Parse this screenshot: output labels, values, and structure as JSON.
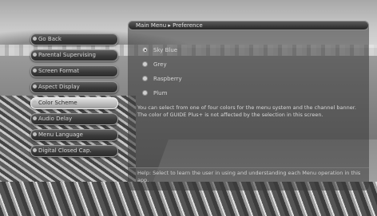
{
  "panel": {
    "title": "Main Menu ▸ Preference",
    "options": [
      {
        "label": "Sky Blue",
        "selected": true
      },
      {
        "label": "Grey",
        "selected": false
      },
      {
        "label": "Raspberry",
        "selected": false
      },
      {
        "label": "Plum",
        "selected": false
      }
    ],
    "description": "You can select from one of four colors for the menu system and the channel banner. The color of GUIDE Plus+ is not affected by the selection in this screen.",
    "help": "Help: Select to learn the user in using and understanding each Menu operation in this app."
  },
  "menu": {
    "items": [
      {
        "label": "Go Back"
      },
      {
        "label": "Parental Supervising"
      },
      {
        "label": "Screen Format"
      },
      {
        "label": "Aspect Display"
      },
      {
        "label": "Color Scheme"
      },
      {
        "label": "Audio Delay"
      },
      {
        "label": "Menu Language"
      },
      {
        "label": "Digital Closed Cap."
      }
    ],
    "selected_index": 4
  }
}
